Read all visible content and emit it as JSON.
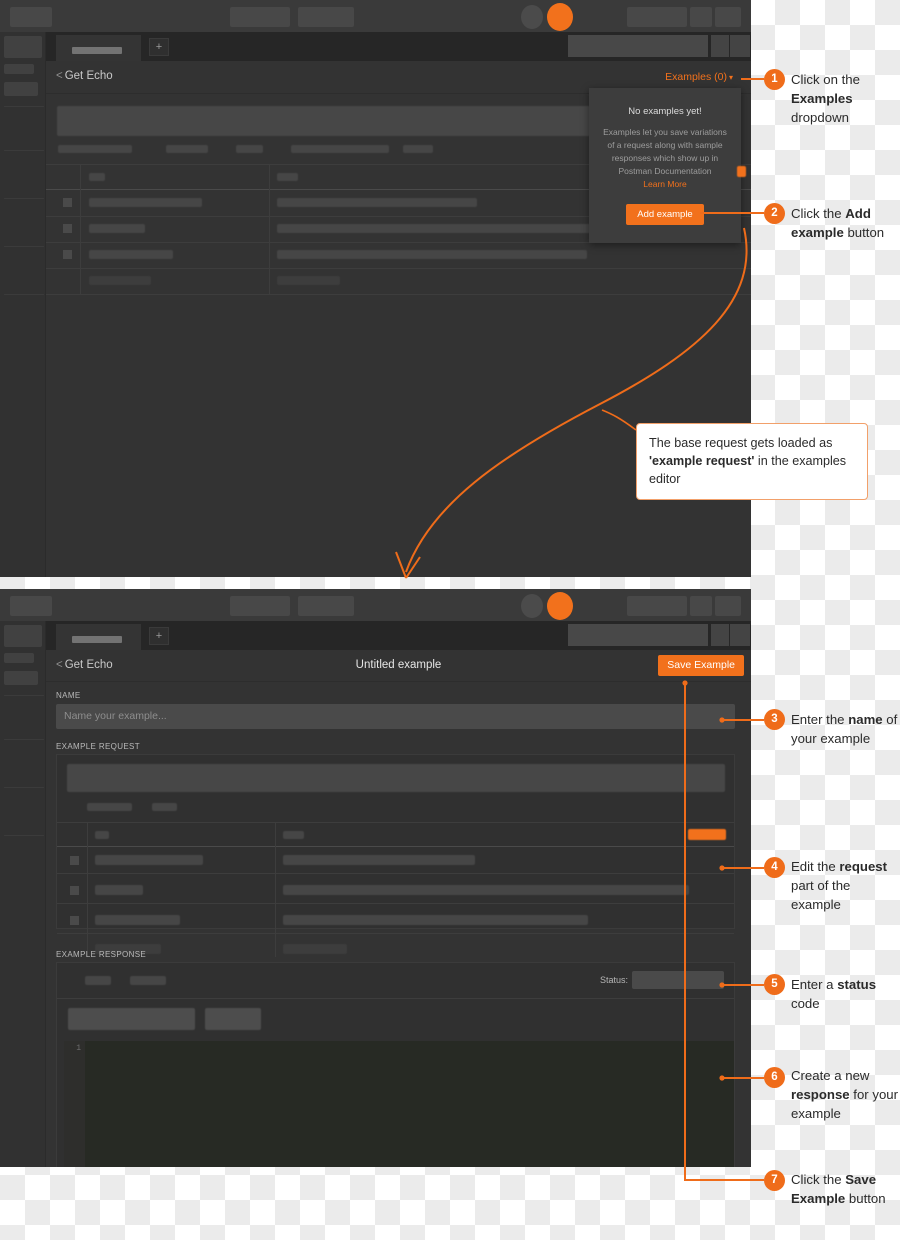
{
  "app": {
    "request_title": "Get Echo",
    "back_chevron": "<",
    "examples_link": "Examples (0)",
    "caret": "▾",
    "tab_plus": "+",
    "example_title": "Untitled example",
    "save_example_button": "Save Example"
  },
  "examples_popover": {
    "title": "No examples yet!",
    "body": "Examples let you save variations of a request along with sample responses which show up in Postman Documentation",
    "learn_more": "Learn More",
    "add_example_button": "Add example"
  },
  "example_editor": {
    "name_label": "NAME",
    "name_placeholder": "Name your example...",
    "name_value": "",
    "example_request_label": "EXAMPLE REQUEST",
    "example_response_label": "EXAMPLE RESPONSE",
    "status_label": "Status:",
    "status_value": "",
    "code_line_number": "1"
  },
  "callout": {
    "line1_pre": "The base request gets loaded as ",
    "bold": "'example request'",
    "line1_post": " in the examples editor"
  },
  "steps": [
    {
      "n": "1",
      "pre": "Click on the ",
      "bold": "Examples",
      "post": " dropdown"
    },
    {
      "n": "2",
      "pre": "Click the ",
      "bold": "Add example",
      "post": " button"
    },
    {
      "n": "3",
      "pre": "Enter the ",
      "bold": "name",
      "post": " of your example"
    },
    {
      "n": "4",
      "pre": "Edit the ",
      "bold": "request",
      "post": " part of the example"
    },
    {
      "n": "5",
      "pre": "Enter a ",
      "bold": "status",
      "post": " code"
    },
    {
      "n": "6",
      "pre": "Create a new ",
      "bold": "response",
      "post": " for your example"
    },
    {
      "n": "7",
      "pre": "Click the ",
      "bold": "Save Example",
      "post": " button"
    }
  ],
  "colors": {
    "accent": "#f2711c",
    "badge": "#ef6c1a",
    "app_bg": "#343434",
    "panel_bg": "#333333",
    "topbar_bg": "#3a3a3a",
    "tabbar_bg": "#262626",
    "text_light": "#e6e6e6",
    "text_muted": "#9d9d9d",
    "code_bg": "#272a24",
    "note_text": "#2b2b2b"
  }
}
